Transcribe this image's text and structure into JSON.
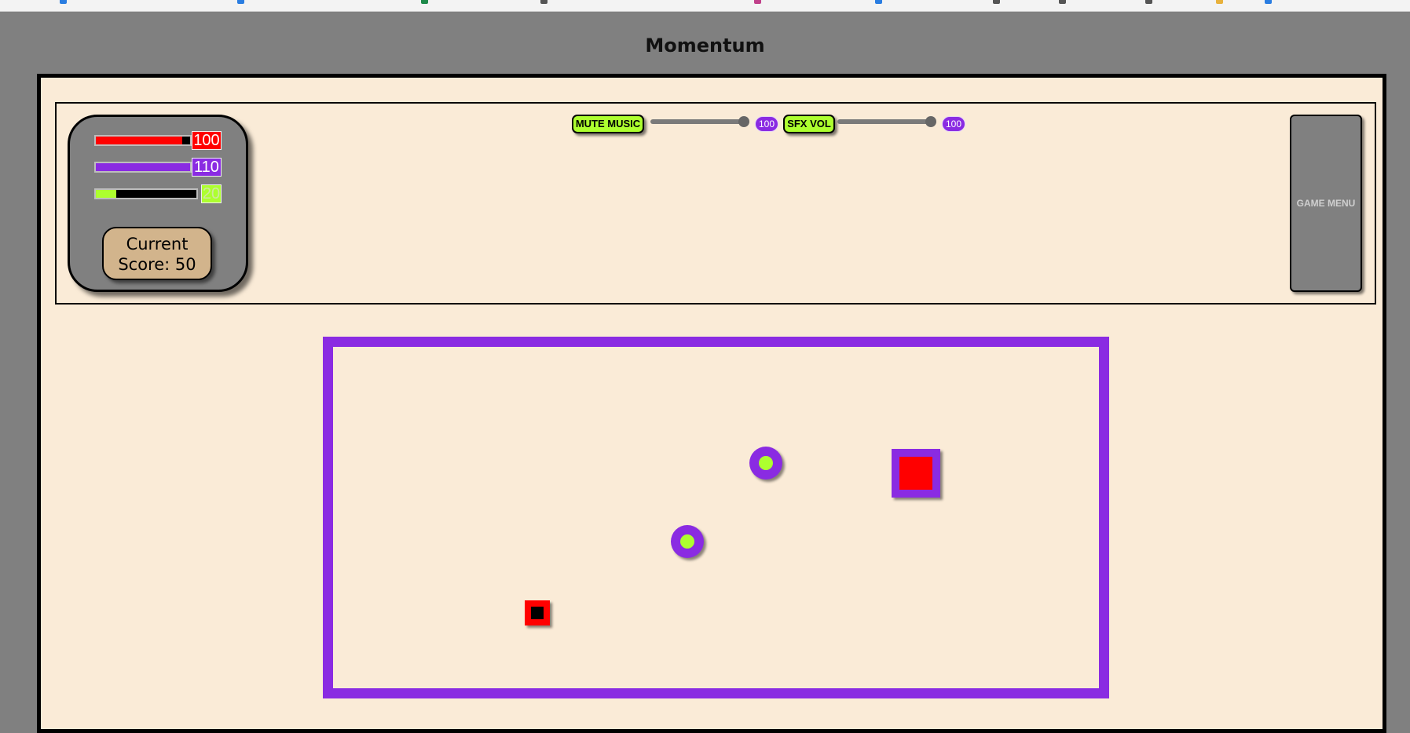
{
  "page": {
    "title": "Momentum"
  },
  "stats": {
    "health": {
      "value": "100",
      "fraction": 0.92,
      "color": "#ff0000"
    },
    "energy": {
      "value": "110",
      "fraction": 1.0,
      "color": "#8a2be2"
    },
    "momentum": {
      "value": "20",
      "fraction": 0.2,
      "color": "#adff2f"
    },
    "score_label": "Current Score: 50"
  },
  "audio": {
    "mute_music_label": "MUTE MUSIC",
    "music_volume": "100",
    "sfx_label": "SFX VOL",
    "sfx_volume": "100"
  },
  "menu": {
    "game_menu_label": "GAME MENU"
  },
  "colors": {
    "background": "#808080",
    "panel_bg": "#faebd7",
    "accent_purple": "#8a2be2",
    "accent_green": "#adff2f",
    "danger_red": "#ff0000",
    "score_bg": "#d2b48c"
  }
}
